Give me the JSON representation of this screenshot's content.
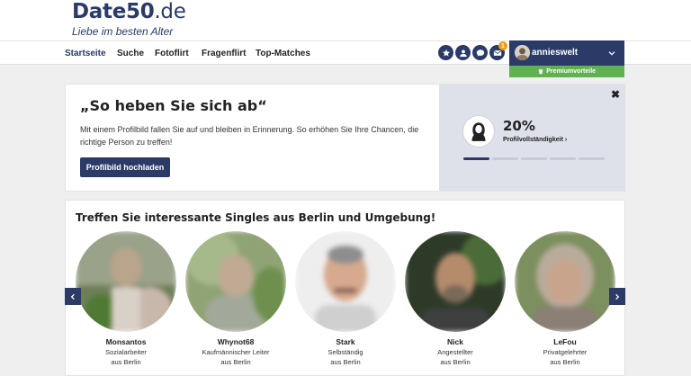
{
  "header": {
    "logo_main": "Date50",
    "logo_tld": ".de",
    "tagline": "Liebe im besten Alter"
  },
  "nav": {
    "items": [
      {
        "label": "Startseite",
        "active": true
      },
      {
        "label": "Suche",
        "active": false
      },
      {
        "label": "Fotoflirt",
        "active": false
      },
      {
        "label": "Fragenflirt",
        "active": false
      },
      {
        "label": "Top-Matches",
        "active": false
      }
    ]
  },
  "toolbar": {
    "icons": [
      "star-icon",
      "user-icon",
      "chat-icon",
      "mail-icon"
    ],
    "mail_badge": "1"
  },
  "user": {
    "name": "annieswelt",
    "premium_label": "Premiumvorteile"
  },
  "profile_card": {
    "title": "„So heben Sie sich ab“",
    "description": "Mit einem Profilbild fallen Sie auf und bleiben in Erinnerung. So erhöhen Sie Ihre Chancen, die richtige Person zu treffen!",
    "button_label": "Profilbild hochladen",
    "close_glyph": "✖",
    "completeness_percent": "20%",
    "completeness_label": "Profilvollständigkeit",
    "completeness_fraction": 0.2,
    "progress_segments": 5,
    "progress_filled": 1
  },
  "singles": {
    "title": "Treffen Sie interessante Singles aus Berlin und Umgebung!",
    "people": [
      {
        "name": "Monsantos",
        "job": "Sozialarbeiter",
        "location": "aus Berlin"
      },
      {
        "name": "Whynot68",
        "job": "Kaufmännischer Leiter",
        "location": "aus Berlin"
      },
      {
        "name": "Stark",
        "job": "Selbständig",
        "location": "aus Berlin"
      },
      {
        "name": "Nick",
        "job": "Angestellter",
        "location": "aus Berlin"
      },
      {
        "name": "LeFou",
        "job": "Privatgelehrter",
        "location": "aus Berlin"
      }
    ]
  },
  "colors": {
    "brand": "#2b3a67",
    "premium": "#5fb24f",
    "badge": "#f39c12",
    "panel": "#dee0ea"
  }
}
